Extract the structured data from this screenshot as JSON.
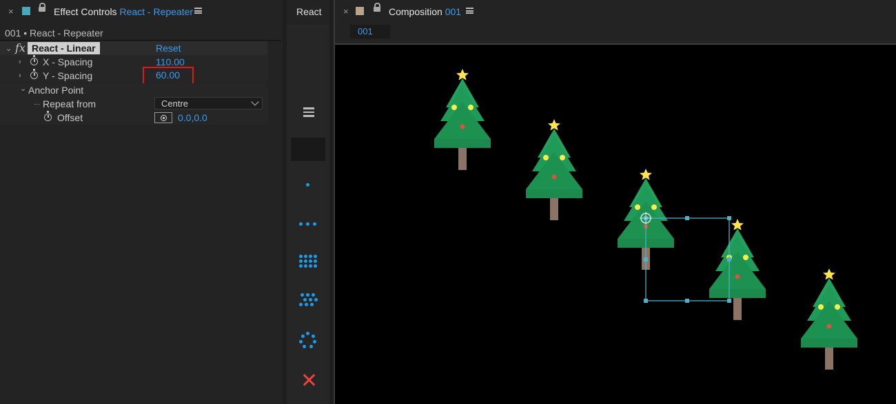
{
  "effect_controls": {
    "close": "×",
    "swatch_color": "#4aa9b8",
    "title": "Effect Controls",
    "layer_link": "React - Repeater",
    "menu_icon": "hamburger-icon",
    "layer_path": "001 • React - Repeater",
    "effect": {
      "fx_symbol": "fx",
      "name": "React - Linear",
      "reset_label": "Reset"
    },
    "properties": [
      {
        "label": "X - Spacing",
        "value": "110.00"
      },
      {
        "label": "Y - Spacing",
        "value": "60.00"
      },
      {
        "label": "Anchor Point"
      },
      {
        "label": "Repeat from",
        "value": "Centre"
      },
      {
        "label": "Offset",
        "value": "0.0,0.0"
      }
    ]
  },
  "repeater_panel": {
    "tab": "React - Repeater",
    "buttons": [
      "hamburger-icon",
      "single-dot-icon",
      "three-dots-icon",
      "grid-dots-icon",
      "staggered-grid-icon",
      "radial-dots-icon",
      "close-x-icon"
    ],
    "accent": "#1e9be6",
    "close_color": "#e8443a"
  },
  "composition": {
    "close": "×",
    "swatch_color": "#b9a487",
    "title": "Composition",
    "comp_link": "001",
    "menu_icon": "hamburger-icon",
    "sub_tab": "001",
    "colors": {
      "background": "#000000",
      "tree_top": "#21a15c",
      "tree_bottom": "#1b8f4c",
      "trunk": "#8b7466",
      "star": "#ffe44d",
      "ornament_yellow": "#f6ef4c",
      "ornament_red": "#d9543a",
      "selection": "#4fb0c6"
    },
    "tree_count": 5
  }
}
